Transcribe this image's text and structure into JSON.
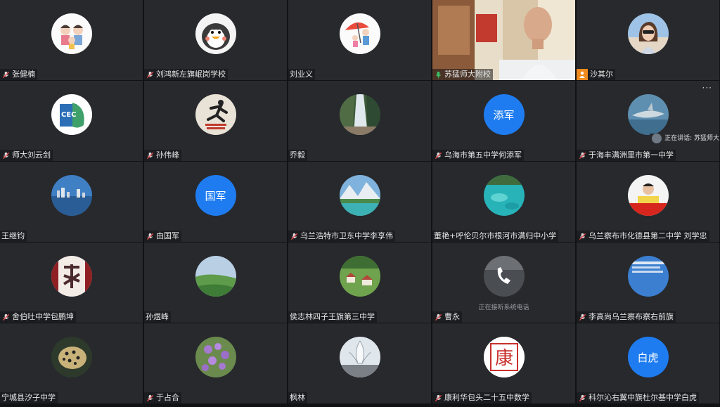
{
  "tiles": [
    {
      "name": "张健楠",
      "mic": "muted",
      "avatar": "family-cartoon-icon"
    },
    {
      "name": "刘鸿新左旗岷岗学校",
      "mic": "muted",
      "avatar": "penguin-cartoon-icon"
    },
    {
      "name": "刘业义",
      "mic": "none",
      "avatar": "umbrella-cartoon-icon"
    },
    {
      "name": "苏猛师大附校",
      "mic": "active",
      "avatar": "video"
    },
    {
      "name": "沙其尔",
      "mic": "user-badge",
      "avatar": "woman-photo-icon"
    },
    {
      "name": "师大刘云剑",
      "mic": "muted",
      "avatar": "cec-logo-icon"
    },
    {
      "name": "孙伟峰",
      "mic": "muted",
      "avatar": "runner-icon"
    },
    {
      "name": "乔毅",
      "mic": "none",
      "avatar": "waterfall-icon"
    },
    {
      "name": "乌海市第五中学何添军",
      "mic": "muted",
      "avatar": "text",
      "avatar_text": "添军"
    },
    {
      "name": "于海丰满洲里市第一中学",
      "mic": "muted",
      "avatar": "shark-icon"
    },
    {
      "name": "王继钧",
      "mic": "none",
      "avatar": "city-skyline-icon"
    },
    {
      "name": "由国军",
      "mic": "muted",
      "avatar": "text",
      "avatar_text": "国军"
    },
    {
      "name": "乌兰浩特市卫东中学李享伟",
      "mic": "muted",
      "avatar": "mountain-lake-icon"
    },
    {
      "name": "董艳+呼伦贝尔市根河市满归中小学",
      "mic": "none",
      "avatar": "turquoise-water-icon"
    },
    {
      "name": "乌兰察布市化德县第二中学 刘学忠",
      "mic": "muted",
      "avatar": "child-photo-icon"
    },
    {
      "name": "舍伯吐中学包鹏坤",
      "mic": "muted",
      "avatar": "calligraphy-icon"
    },
    {
      "name": "孙煜峰",
      "mic": "none",
      "avatar": "grassland-icon"
    },
    {
      "name": "侯志林四子王旗第三中学",
      "mic": "none",
      "avatar": "village-icon"
    },
    {
      "name": "曹永",
      "mic": "muted",
      "avatar": "phone-icon"
    },
    {
      "name": "李高尚乌兰察布察右前旗",
      "mic": "muted",
      "avatar": "document-icon"
    },
    {
      "name": "宁城县汐子中学",
      "mic": "none",
      "avatar": "leopard-icon"
    },
    {
      "name": "于占合",
      "mic": "muted",
      "avatar": "flowers-icon"
    },
    {
      "name": "枫林",
      "mic": "none",
      "avatar": "sculpture-icon"
    },
    {
      "name": "康利华包头二十五中数学",
      "mic": "muted",
      "avatar": "kang-seal-icon",
      "avatar_text": "康"
    },
    {
      "name": "科尔沁右翼中旗杜尔基中学白虎",
      "mic": "muted",
      "avatar": "text",
      "avatar_text": "白虎"
    }
  ],
  "phone_status": "正在接听系统电话",
  "speaking_label": "正在讲话: 苏猛师大",
  "more_menu": "···",
  "colors": {
    "tile_bg": "#27292d",
    "text_avatar_blue": "#1e7cf0",
    "badge_orange": "#f08a1c",
    "active_mic": "#3cc266"
  }
}
